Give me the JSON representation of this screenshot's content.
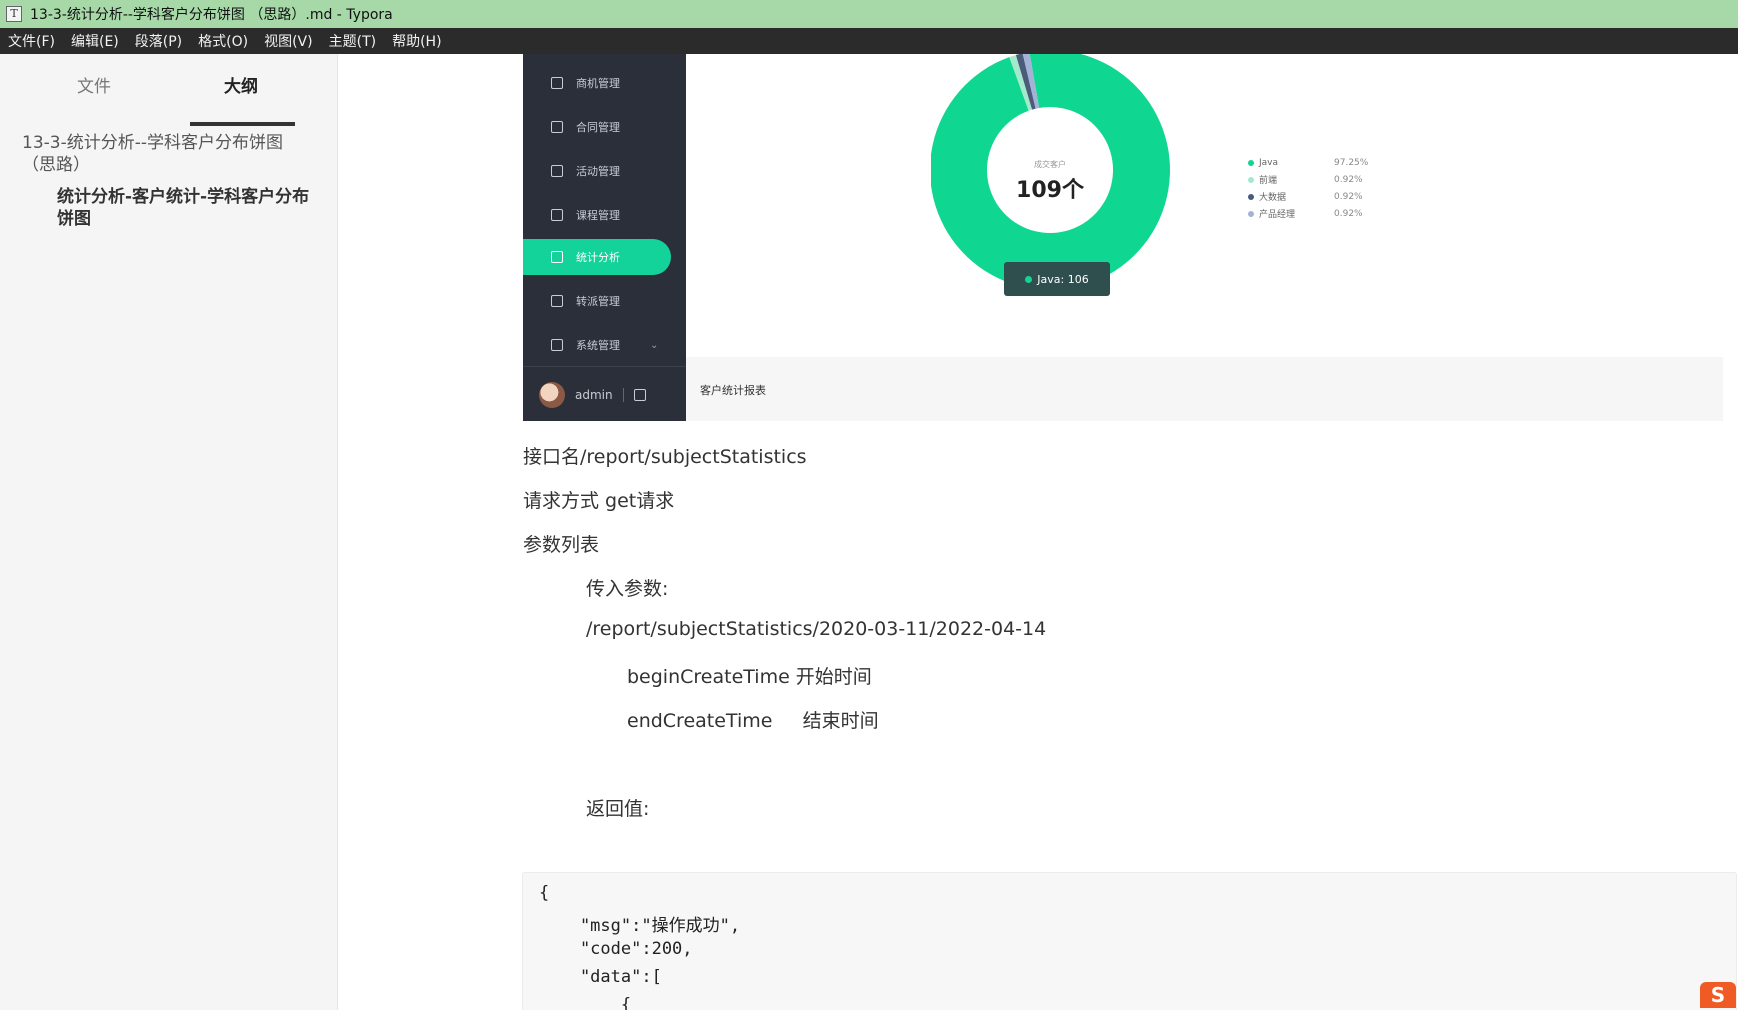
{
  "window": {
    "app_icon": "T",
    "title": "13-3-统计分析--学科客户分布饼图 （思路）.md - Typora"
  },
  "menu": [
    "文件(F)",
    "编辑(E)",
    "段落(P)",
    "格式(O)",
    "视图(V)",
    "主题(T)",
    "帮助(H)"
  ],
  "sidebar": {
    "tab_files": "文件",
    "tab_outline": "大纲",
    "outline": [
      {
        "label": "13-3-统计分析--学科客户分布饼图 （思路）"
      },
      {
        "label": "统计分析-客户统计-学科客户分布饼图"
      }
    ],
    "footer_back": "<",
    "footer_source": "</>"
  },
  "screenshot": {
    "nav": [
      {
        "label": "商机管理",
        "icon": "target-icon"
      },
      {
        "label": "合同管理",
        "icon": "document-icon"
      },
      {
        "label": "活动管理",
        "icon": "star-icon"
      },
      {
        "label": "课程管理",
        "icon": "play-icon"
      },
      {
        "label": "统计分析",
        "icon": "chart-icon",
        "active": true
      },
      {
        "label": "转派管理",
        "icon": "refresh-icon"
      },
      {
        "label": "系统管理",
        "icon": "gear-icon"
      }
    ],
    "user": "admin",
    "center_small": "成交客户",
    "center_big": "109个",
    "tooltip": "Java: 106",
    "report_label": "客户统计报表",
    "legend": [
      {
        "name": "Java",
        "pct": "97.25%",
        "color": "#0fd690"
      },
      {
        "name": "前端",
        "pct": "0.92%",
        "color": "#a5e9cc"
      },
      {
        "name": "大数据",
        "pct": "0.92%",
        "color": "#4b5b7a"
      },
      {
        "name": "产品经理",
        "pct": "0.92%",
        "color": "#a3b2d6"
      }
    ],
    "slices": [
      {
        "name": "Java",
        "value": 106,
        "color": "#0fd690"
      },
      {
        "name": "前端",
        "value": 1,
        "color": "#a5e9cc"
      },
      {
        "name": "大数据",
        "value": 1,
        "color": "#4b5b7a"
      },
      {
        "name": "产品经理",
        "value": 1,
        "color": "#a3b2d6"
      }
    ]
  },
  "doc": {
    "line1": "接口名/report/subjectStatistics",
    "line2": "请求方式 get请求",
    "line3": "参数列表",
    "line4": "传入参数:",
    "line5": "/report/subjectStatistics/2020-03-11/2022-04-14",
    "line6": "beginCreateTime 开始时间",
    "line7": "endCreateTime     结束时间",
    "line8": "返回值:",
    "code": [
      "{",
      "    \"msg\":\"操作成功\",",
      "    \"code\":200,",
      "    \"data\":[",
      "        {"
    ]
  }
}
